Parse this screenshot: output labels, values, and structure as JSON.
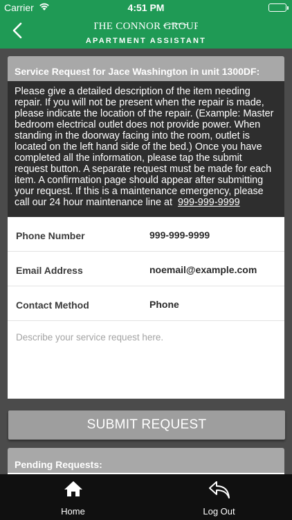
{
  "status_bar": {
    "carrier": "Carrier",
    "time": "4:51 PM"
  },
  "nav": {
    "logo_brand": "The Connor Group",
    "logo_sub": "APARTMENT ASSISTANT",
    "back_icon": "chevron-left-icon"
  },
  "request": {
    "header": "Service Request for Jace Washington in unit 1300DF:",
    "instructions": "Please give a detailed description of the item needing repair. If you will not be present when the repair is made, please indicate the location of the repair. (Example: Master bedroom electrical outlet does not provide power. When standing in the doorway facing into the room, outlet is located on the left hand side of the bed.) Once you have completed all the information, please tap the submit request button. A separate request must be made for each item. A confirmation page should appear after submitting your request. If this is a maintenance emergency, please call our 24 hour maintenance line at",
    "maintenance_phone": "999-999-9999"
  },
  "form": {
    "phone_label": "Phone Number",
    "phone_value": "999-999-9999",
    "email_label": "Email Address",
    "email_value": "noemail@example.com",
    "contact_label": "Contact Method",
    "contact_value": "Phone",
    "description_placeholder": "Describe your service request here."
  },
  "submit_label": "SUBMIT REQUEST",
  "pending_header": "Pending Requests:",
  "tabs": [
    {
      "label": "Home",
      "icon": "home-icon"
    },
    {
      "label": "Log Out",
      "icon": "logout-icon"
    }
  ],
  "colors": {
    "brand_green": "#1f9a55",
    "section_gray": "#a8a8a8",
    "background": "#4b4b4b",
    "tab_bar": "#101010"
  }
}
